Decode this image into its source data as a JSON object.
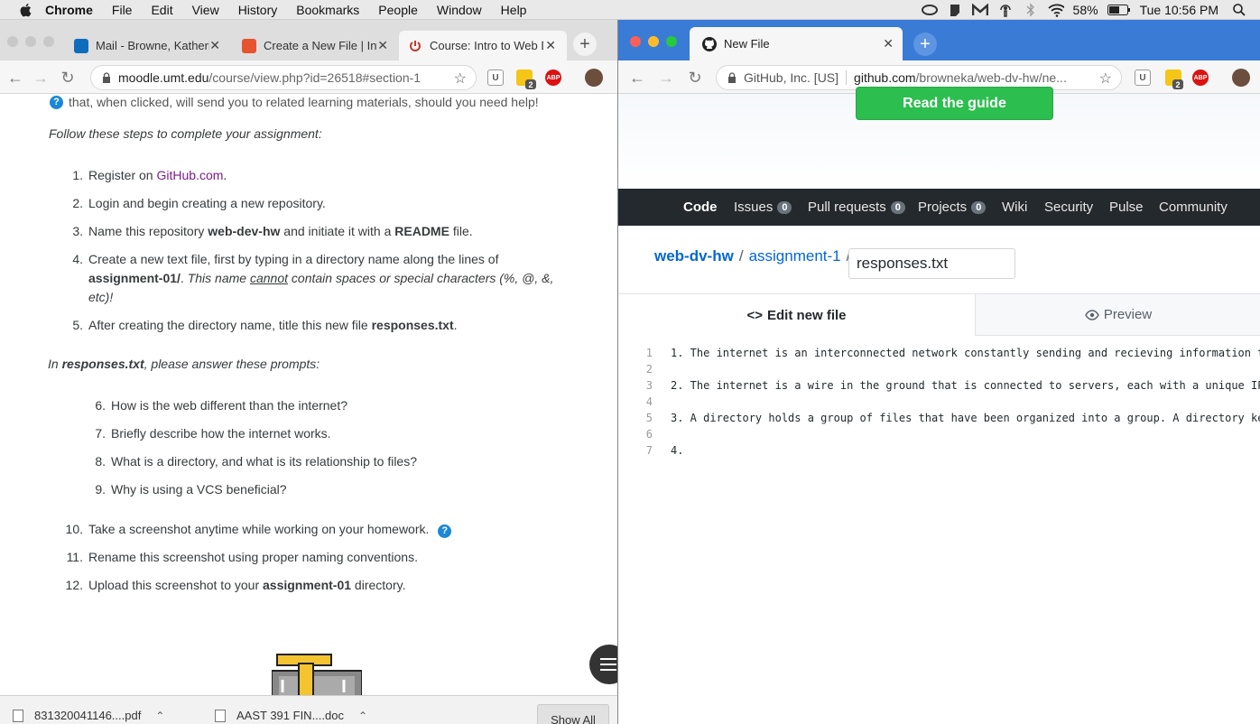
{
  "menubar": {
    "items": [
      "Chrome",
      "File",
      "Edit",
      "View",
      "History",
      "Bookmarks",
      "People",
      "Window",
      "Help"
    ],
    "battery": "58%",
    "clock": "Tue 10:56 PM"
  },
  "left_browser": {
    "tabs": [
      {
        "title": "Mail - Browne, Katherine"
      },
      {
        "title": "Create a New File | Intro"
      },
      {
        "title": "Course: Intro to Web D..."
      }
    ],
    "url_host": "moodle.umt.edu",
    "url_path": "/course/view.php?id=26518#section-1",
    "extension_badge": "2",
    "abp_label": "ABP",
    "content": {
      "help_line": "that, when clicked, will send you to related learning materials, should you need help!",
      "intro": "Follow these steps to complete your assignment:",
      "steps": [
        {
          "num": "1.",
          "pre": "Register on ",
          "link": "GitHub.com",
          "post": "."
        },
        {
          "num": "2.",
          "text": "Login and begin creating a new repository."
        },
        {
          "num": "3.",
          "pre": "Name this repository ",
          "b1": "web-dev-hw",
          "mid": " and initiate it with a ",
          "b2": "README",
          "post": " file."
        },
        {
          "num": "4.",
          "line1": "Create a new text file, first by typing in a directory name along the lines of",
          "b1": "assignment-01/",
          "post1": ". ",
          "i1": "This name ",
          "u1": "cannot",
          "i2": " contain spaces or special characters (%, @, &,",
          "i3": "etc)!"
        },
        {
          "num": "5.",
          "pre": "After creating the directory name, title this new file ",
          "b1": "responses.txt",
          "post": "."
        }
      ],
      "prompt_intro_pre": "In ",
      "prompt_intro_bold": "responses.txt",
      "prompt_intro_post": ", please answer these prompts:",
      "prompts": [
        {
          "num": "6.",
          "text": "How is the web different than the internet?"
        },
        {
          "num": "7.",
          "text": "Briefly describe how the internet works."
        },
        {
          "num": "8.",
          "text": "What is a directory, and what is its relationship to files?"
        },
        {
          "num": "9.",
          "text": "Why is using a VCS beneficial?"
        }
      ],
      "final_steps": [
        {
          "num": "10.",
          "text": "Take a screenshot anytime while working on your homework."
        },
        {
          "num": "11.",
          "text": "Rename this screenshot using proper naming conventions."
        },
        {
          "num": "12.",
          "pre": "Upload this screenshot to your ",
          "b1": "assignment-01",
          "post": " directory."
        }
      ]
    },
    "downloads": [
      {
        "name": "831320041146....pdf"
      },
      {
        "name": "AAST 391 FIN....doc"
      }
    ],
    "show_all": "Show All"
  },
  "right_browser": {
    "tab_title": "New File",
    "url_owner": "GitHub, Inc. [US]",
    "url_host": "github.com",
    "url_path": "/browneka/web-dv-hw/ne...",
    "extension_badge": "2",
    "abp_label": "ABP",
    "guide_button": "Read the guide",
    "repo_nav": [
      {
        "label": "Code",
        "count": ""
      },
      {
        "label": "Issues",
        "count": "0"
      },
      {
        "label": "Pull requests",
        "count": "0"
      },
      {
        "label": "Projects",
        "count": "0"
      },
      {
        "label": "Wiki",
        "count": ""
      },
      {
        "label": "Security",
        "count": ""
      },
      {
        "label": "Pulse",
        "count": ""
      },
      {
        "label": "Community",
        "count": ""
      }
    ],
    "breadcrumb": {
      "repo": "web-dv-hw",
      "dir": "assignment-1",
      "sep": "/"
    },
    "filename_value": "responses.txt",
    "edit_tab": "Edit new file",
    "preview_tab": "Preview",
    "code_lines": [
      {
        "n": "1",
        "text": "1. The internet is an interconnected network constantly sending and recieving information t"
      },
      {
        "n": "2",
        "text": ""
      },
      {
        "n": "3",
        "text": "2. The internet is a wire in the ground that is connected to servers, each with a unique IP"
      },
      {
        "n": "4",
        "text": ""
      },
      {
        "n": "5",
        "text": "3. A directory holds a group of files that have been organized into a group. A directory ke"
      },
      {
        "n": "6",
        "text": ""
      },
      {
        "n": "7",
        "text": "4."
      }
    ]
  }
}
